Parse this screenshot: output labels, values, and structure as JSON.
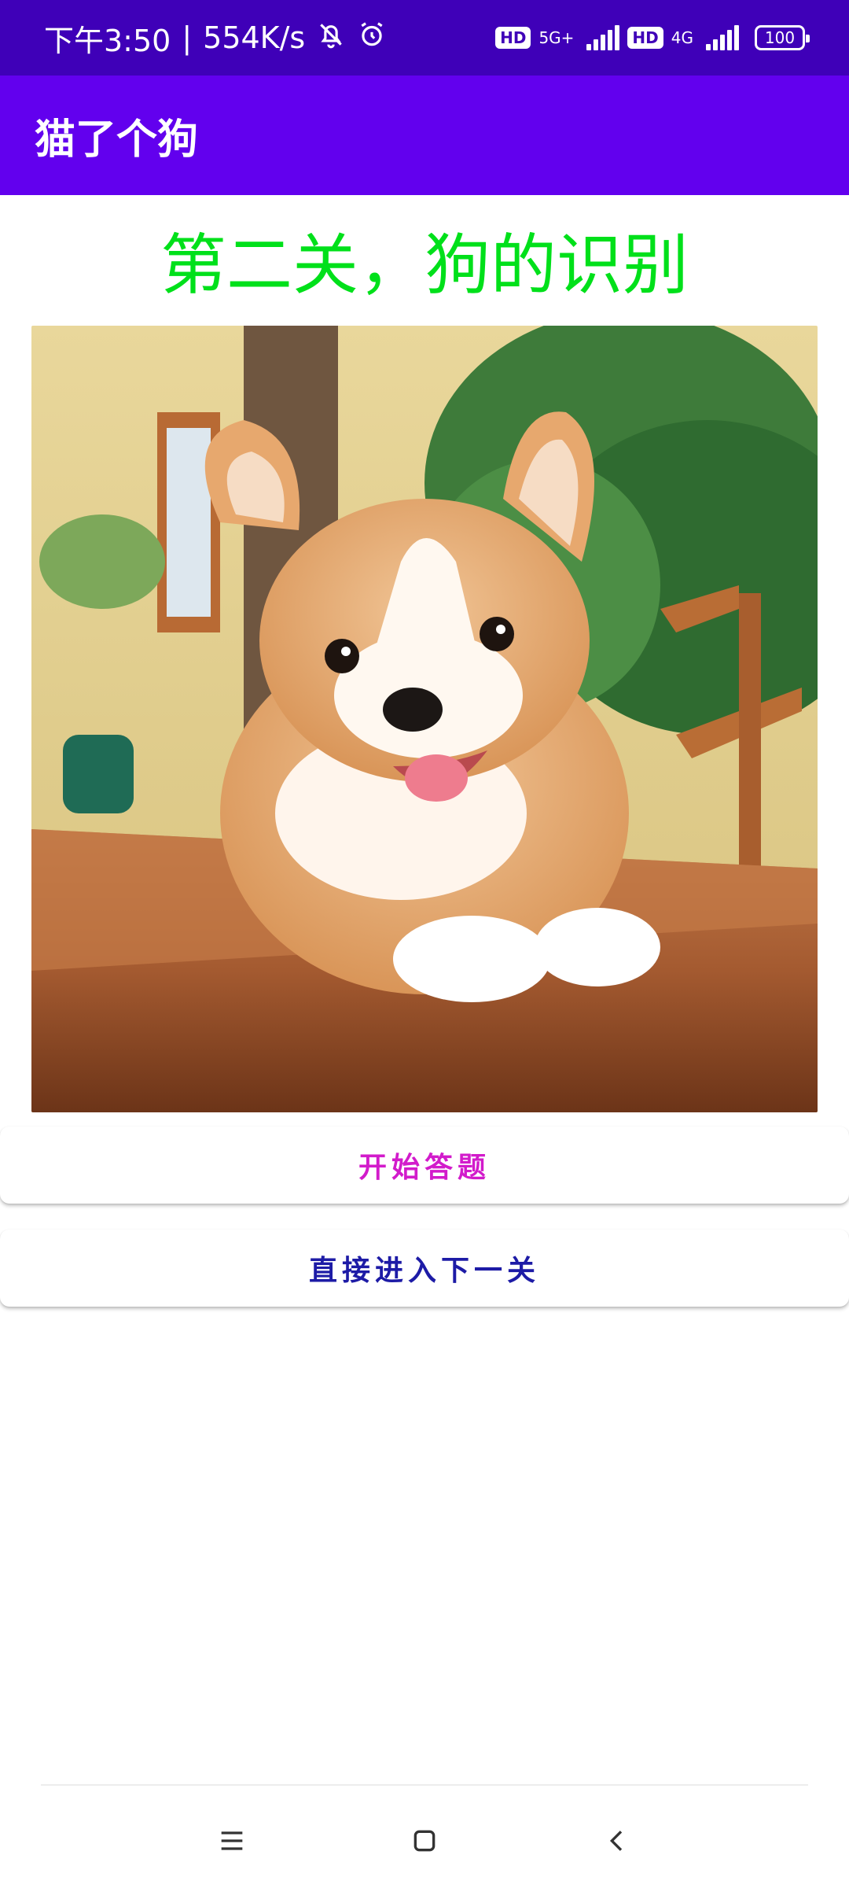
{
  "status_bar": {
    "time": "下午3:50",
    "network_speed": "554K/s",
    "hd_label_1": "HD",
    "network_1": "5G+",
    "hd_label_2": "HD",
    "network_2": "4G",
    "battery": "100"
  },
  "app_bar": {
    "title": "猫了个狗"
  },
  "main": {
    "level_title": "第二关，狗的识别",
    "image_icon": "corgi-photo",
    "start_button": "开始答题",
    "next_level_button": "直接进入下一关"
  },
  "nav_bar": {
    "menu_icon": "menu-icon",
    "home_icon": "home-icon",
    "back_icon": "back-icon"
  },
  "colors": {
    "status_bar_bg": "#3F00B8",
    "app_bar_bg": "#6200EE",
    "level_title": "#00E01A",
    "start_button_text": "#D21BCB",
    "next_button_text": "#1D1BA6"
  }
}
